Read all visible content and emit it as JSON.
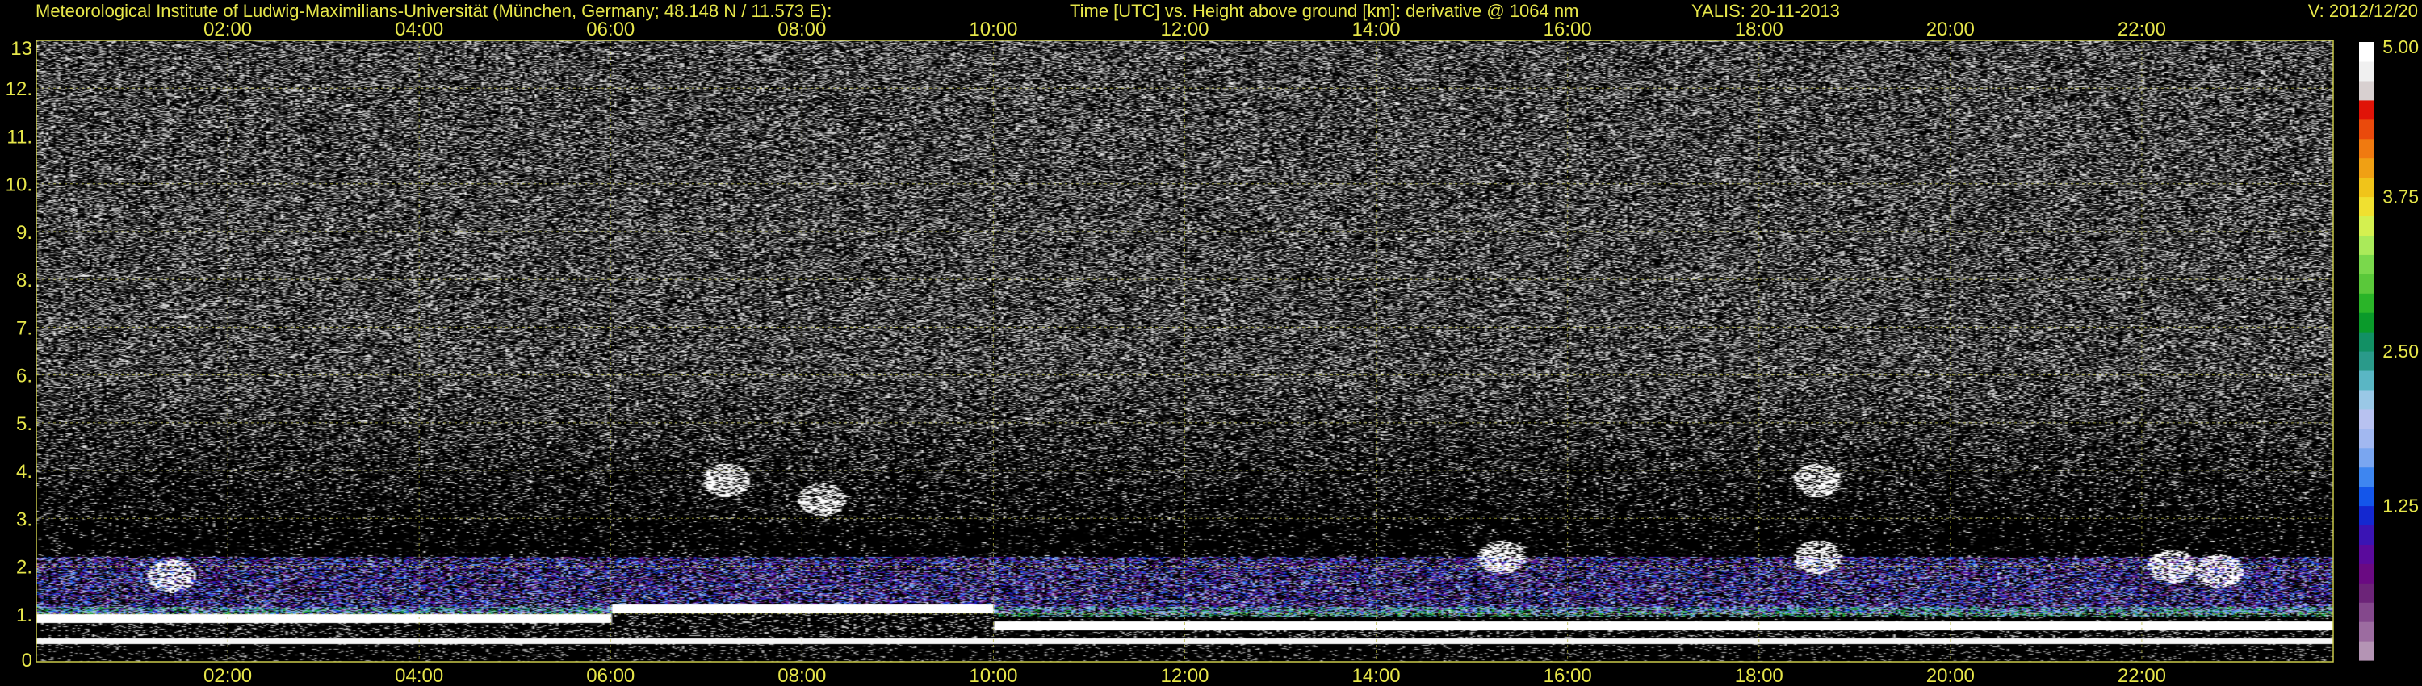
{
  "chart_data": {
    "type": "heatmap",
    "title_left": "Meteorological Institute of Ludwig-Maximilians-Universität (München, Germany; 48.148 N / 11.573 E):",
    "title_center": "Time [UTC] vs. Height above ground [km]: derivative @ 1064 nm",
    "title_station": "YALIS: 20-11-2013",
    "title_version": "V: 2012/12/20",
    "x_axis": {
      "label": "Time [UTC]",
      "range_hours": [
        0,
        24
      ],
      "ticks": [
        {
          "hour": 2,
          "label": "02:00"
        },
        {
          "hour": 4,
          "label": "04:00"
        },
        {
          "hour": 6,
          "label": "06:00"
        },
        {
          "hour": 8,
          "label": "08:00"
        },
        {
          "hour": 10,
          "label": "10:00"
        },
        {
          "hour": 12,
          "label": "12:00"
        },
        {
          "hour": 14,
          "label": "14:00"
        },
        {
          "hour": 16,
          "label": "16:00"
        },
        {
          "hour": 18,
          "label": "18:00"
        },
        {
          "hour": 20,
          "label": "20:00"
        },
        {
          "hour": 22,
          "label": "22:00"
        }
      ]
    },
    "y_axis": {
      "label": "Height above ground [km]",
      "range_km": [
        0,
        13
      ],
      "ticks": [
        {
          "km": 0,
          "label": "0"
        },
        {
          "km": 1,
          "label": "1."
        },
        {
          "km": 2,
          "label": "2."
        },
        {
          "km": 3,
          "label": "3."
        },
        {
          "km": 4,
          "label": "4."
        },
        {
          "km": 5,
          "label": "5."
        },
        {
          "km": 6,
          "label": "6."
        },
        {
          "km": 7,
          "label": "7."
        },
        {
          "km": 8,
          "label": "8."
        },
        {
          "km": 9,
          "label": "9."
        },
        {
          "km": 10,
          "label": "10."
        },
        {
          "km": 11,
          "label": "11."
        },
        {
          "km": 12,
          "label": "12."
        },
        {
          "km": 13,
          "label": "13"
        }
      ]
    },
    "colorbar": {
      "range": [
        0,
        5
      ],
      "ticks": [
        {
          "value": 1.25,
          "label": "1.25"
        },
        {
          "value": 2.5,
          "label": "2.50"
        },
        {
          "value": 3.75,
          "label": "3.75"
        },
        {
          "value": 5.0,
          "label": "5.00"
        }
      ],
      "colors": [
        "#b494b4",
        "#9c6ca0",
        "#84488c",
        "#6c2478",
        "#6a0a82",
        "#5a0a9c",
        "#3a14b4",
        "#1428d0",
        "#1456ea",
        "#3e86f0",
        "#7aa6f0",
        "#a2b8f0",
        "#b8c2f0",
        "#9ac8e6",
        "#5ab6c4",
        "#2a9a8a",
        "#129064",
        "#0a9a2a",
        "#2ab428",
        "#5ac83a",
        "#7ad84c",
        "#aaea5a",
        "#d4f050",
        "#f0e030",
        "#f0c41a",
        "#f0a014",
        "#f07a10",
        "#ea4a0c",
        "#e01408",
        "#d8d0d0",
        "#f0f0f0",
        "#ffffff"
      ]
    },
    "grid": true,
    "grid_color": "#b4b43c",
    "features": {
      "residual_layer_top_km": 1.0,
      "surface_layer_top_km": 0.5,
      "aerosol_layer_top_km": 2.0,
      "elevated_features": [
        {
          "hour": 7.2,
          "km": 3.8
        },
        {
          "hour": 8.2,
          "km": 3.4
        },
        {
          "hour": 1.4,
          "km": 1.8
        },
        {
          "hour": 18.6,
          "km": 3.8
        },
        {
          "hour": 18.6,
          "km": 2.2
        },
        {
          "hour": 22.3,
          "km": 2.0
        },
        {
          "hour": 15.3,
          "km": 2.2
        },
        {
          "hour": 22.8,
          "km": 1.9
        }
      ]
    }
  }
}
